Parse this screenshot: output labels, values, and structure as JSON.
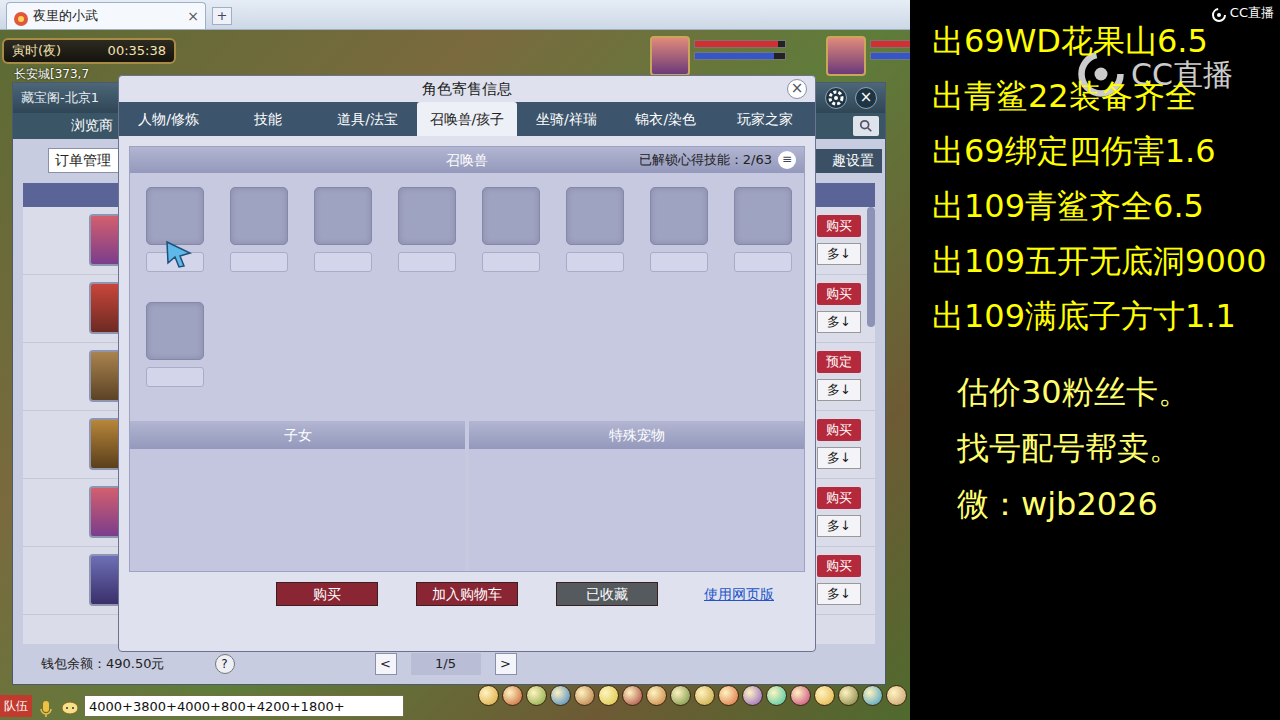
{
  "browser_tab": {
    "title": "夜里的小武",
    "close": "×",
    "new_tab": "+"
  },
  "game": {
    "time": "寅时(夜)",
    "clock": "00:35:38",
    "location": "长安城[373,7"
  },
  "party": [
    {
      "hp": 0.92,
      "mp": 0.88
    },
    {
      "hp": 0.9,
      "mp": 0.85
    }
  ],
  "cbg": {
    "title": "藏宝阁-北京1",
    "close": "×",
    "browse_tab": "浏览商",
    "order_select": "订单管理",
    "settings_button": "趣设置",
    "rows": [
      {
        "action": "购买",
        "more": "多↓"
      },
      {
        "action": "购买",
        "more": "多↓"
      },
      {
        "action": "预定",
        "more": "多↓"
      },
      {
        "action": "购买",
        "more": "多↓"
      },
      {
        "action": "购买",
        "more": "多↓"
      },
      {
        "action": "购买",
        "more": "多↓"
      }
    ],
    "wallet": "钱包余额：490.50元",
    "help": "?",
    "prev": "<",
    "page": "1/5",
    "next": ">"
  },
  "dialog": {
    "title": "角色寄售信息",
    "close": "×",
    "tabs": [
      {
        "label": "人物/修炼",
        "selected": false
      },
      {
        "label": "技能",
        "selected": false
      },
      {
        "label": "道具/法宝",
        "selected": false
      },
      {
        "label": "召唤兽/孩子",
        "selected": true
      },
      {
        "label": "坐骑/祥瑞",
        "selected": false
      },
      {
        "label": "锦衣/染色",
        "selected": false
      },
      {
        "label": "玩家之家",
        "selected": false
      }
    ],
    "pets": {
      "title": "召唤兽",
      "skills": "已解锁心得技能：2/63",
      "menu": "≡",
      "slots": [
        {
          "filled": false
        },
        {
          "filled": false
        },
        {
          "filled": false
        },
        {
          "filled": false
        },
        {
          "filled": false
        },
        {
          "filled": false
        },
        {
          "filled": false
        },
        {
          "filled": false
        },
        {
          "filled": false
        }
      ]
    },
    "children": {
      "title": "子女"
    },
    "special": {
      "title": "特殊宠物"
    },
    "buttons": [
      {
        "label": "购买",
        "kind": "red"
      },
      {
        "label": "加入购物车",
        "kind": "red"
      },
      {
        "label": "已收藏",
        "kind": "grey"
      }
    ],
    "web_link": "使用网页版"
  },
  "chat": {
    "channel": "队伍",
    "input": "4000+3800+4000+800+4200+1800+"
  },
  "overlay": {
    "corner_logo": "CC直播",
    "watermark": "CC直播",
    "lines": [
      "出69WD花果山6.5",
      "出青鲨22装备齐全",
      "出69绑定四伤害1.6",
      "出109青鲨齐全6.5",
      "出109五开无底洞9000",
      "出109满底子方寸1.1"
    ],
    "notes": [
      "估价30粉丝卡。",
      "找号配号帮卖。",
      "微：wjb2026"
    ]
  }
}
